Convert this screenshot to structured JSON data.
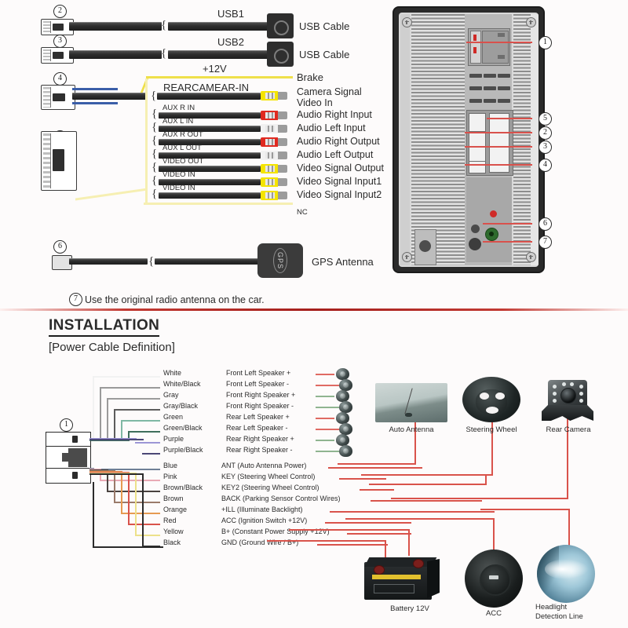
{
  "top_section": {
    "cables": [
      {
        "num": "2",
        "inline_label": "USB1",
        "right_label": "USB Cable"
      },
      {
        "num": "3",
        "inline_label": "USB2",
        "right_label": "USB Cable"
      },
      {
        "num": "4",
        "inline_label": "REARCAMEAR-IN",
        "power_label": "+12V",
        "right_label_1": "Brake",
        "right_label_2": "Camera Signal",
        "right_label_3": "Video In"
      },
      {
        "num": "5"
      },
      {
        "num": "6",
        "right_label": "GPS Antenna",
        "puck_text": "GPS"
      }
    ],
    "aux_rows": [
      {
        "wire_label": "AUX R IN",
        "function": "Audio Right Input",
        "rca_color": "#e02a20"
      },
      {
        "wire_label": "AUX L IN",
        "function": "Audio Left Input",
        "rca_color": "#f1f1f1"
      },
      {
        "wire_label": "AUX R OUT",
        "function": "Audio Right Output",
        "rca_color": "#e02a20"
      },
      {
        "wire_label": "AUX L OUT",
        "function": "Audio Left Output",
        "rca_color": "#f1f1f1"
      },
      {
        "wire_label": "VIDEO OUT",
        "function": "Video Signal Output",
        "rca_color": "#f4e400"
      },
      {
        "wire_label": "VIDEO IN",
        "function": "Video Signal Input1",
        "rca_color": "#f4e400"
      },
      {
        "wire_label": "VIDEO IN",
        "function": "Video Signal Input2",
        "rca_color": "#f4e400"
      }
    ],
    "nc_label": "NC",
    "footnote": {
      "num": "7",
      "text": "Use the original radio antenna on the car."
    }
  },
  "radio_unit": {
    "callouts": [
      "1",
      "5",
      "2",
      "3",
      "4",
      "6",
      "7"
    ]
  },
  "install": {
    "title": "INSTALLATION",
    "subtitle": "[Power Cable Definition]",
    "connector_num": "1",
    "speaker_wires": [
      {
        "color_label": "White",
        "color_hex": "#f2f2f2",
        "function": "Front Left Speaker +",
        "lead_hex": "#e06a63"
      },
      {
        "color_label": "White/Black",
        "color_hex": "#9a9a9a",
        "function": "Front Left Speaker -",
        "lead_hex": "#e06a63"
      },
      {
        "color_label": "Gray",
        "color_hex": "#9b9b9b",
        "function": "Front Right Speaker +",
        "lead_hex": "#8fb490"
      },
      {
        "color_label": "Gray/Black",
        "color_hex": "#5d5d5d",
        "function": "Front Right Speaker -",
        "lead_hex": "#8fb490"
      },
      {
        "color_label": "Green",
        "color_hex": "#7fb8a4",
        "function": "Rear Left Speaker +",
        "lead_hex": "#e06a63"
      },
      {
        "color_label": "Green/Black",
        "color_hex": "#3f6f5c",
        "function": "Rear Left Speaker -",
        "lead_hex": "#e06a63"
      },
      {
        "color_label": "Purple",
        "color_hex": "#9d96d6",
        "function": "Rear Right Speaker +",
        "lead_hex": "#8fb490"
      },
      {
        "color_label": "Purple/Black",
        "color_hex": "#4b4776",
        "function": "Rear Right Speaker -",
        "lead_hex": "#8fb490"
      }
    ],
    "control_wires": [
      {
        "color_label": "Blue",
        "color_hex": "#6f7f96",
        "function": "ANT (Auto Antenna Power)"
      },
      {
        "color_label": "Pink",
        "color_hex": "#e9a9b4",
        "function": "KEY (Steering Wheel Control)"
      },
      {
        "color_label": "Brown/Black",
        "color_hex": "#4a4340",
        "function": "KEY2 (Steering Wheel Control)"
      },
      {
        "color_label": "Brown",
        "color_hex": "#9a7a6a",
        "function": "BACK (Parking Sensor Control Wires)"
      },
      {
        "color_label": "Orange",
        "color_hex": "#e69a52",
        "function": "+ILL (Illuminate Backlight)"
      },
      {
        "color_label": "Red",
        "color_hex": "#d9534b",
        "function": "ACC (Ignition Switch +12V)"
      },
      {
        "color_label": "Yellow",
        "color_hex": "#ece18a",
        "function": "B+ (Constant Power Supply +12V)"
      },
      {
        "color_label": "Black",
        "color_hex": "#2b2b2b",
        "function": "GND (Ground Wire / B+)"
      }
    ],
    "devices": [
      {
        "name": "auto-antenna",
        "caption": "Auto Antenna"
      },
      {
        "name": "steering-wheel",
        "caption": "Steering Wheel"
      },
      {
        "name": "rear-camera",
        "caption": "Rear Camera"
      },
      {
        "name": "battery",
        "caption": "Battery 12V"
      },
      {
        "name": "acc",
        "caption": "ACC"
      },
      {
        "name": "headlight",
        "caption_line1": "Headlight",
        "caption_line2": "Detection Line"
      }
    ]
  },
  "colors": {
    "accent_red": "#b5201f",
    "harness_red": "#d9534b",
    "cable_black": "#3a3a3a",
    "yellow_wire": "#efe04a",
    "blue_wire": "#3b5ea8"
  }
}
